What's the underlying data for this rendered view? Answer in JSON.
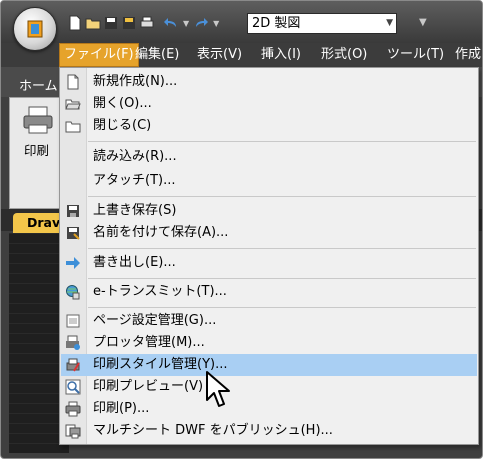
{
  "workspace": {
    "value": "2D 製図"
  },
  "menubar": {
    "items": [
      "ファイル(F)",
      "編集(E)",
      "表示(V)",
      "挿入(I)",
      "形式(O)",
      "ツール(T)",
      "作成"
    ]
  },
  "ribbon": {
    "tab_home": "ホーム",
    "print_label": "印刷"
  },
  "doc_tab": {
    "label": "Drav"
  },
  "file_menu": {
    "items": [
      {
        "label": "新規作成(N)...",
        "icon": "new-file-icon"
      },
      {
        "label": "開く(O)...",
        "icon": "open-folder-icon"
      },
      {
        "label": "閉じる(C)",
        "icon": "close-folder-icon"
      },
      {
        "label": "読み込み(R)...",
        "icon": "none"
      },
      {
        "label": "アタッチ(T)...",
        "icon": "none"
      },
      {
        "label": "上書き保存(S)",
        "icon": "save-icon"
      },
      {
        "label": "名前を付けて保存(A)...",
        "icon": "save-as-icon"
      },
      {
        "label": "書き出し(E)...",
        "icon": "export-arrow-icon"
      },
      {
        "label": "e-トランスミット(T)...",
        "icon": "etransmit-icon"
      },
      {
        "label": "ページ設定管理(G)...",
        "icon": "page-setup-icon"
      },
      {
        "label": "プロッタ管理(M)...",
        "icon": "plotter-manager-icon"
      },
      {
        "label": "印刷スタイル管理(Y)...",
        "icon": "plot-style-icon"
      },
      {
        "label": "印刷プレビュー(V)",
        "icon": "print-preview-icon"
      },
      {
        "label": "印刷(P)...",
        "icon": "print-icon"
      },
      {
        "label": "マルチシート DWF をパブリッシュ(H)...",
        "icon": "publish-icon"
      }
    ],
    "highlighted_index": 11
  },
  "colors": {
    "menu_active": "#e6a32b",
    "highlight": "#a9cff3",
    "titlebar": "#4a4a4a"
  }
}
